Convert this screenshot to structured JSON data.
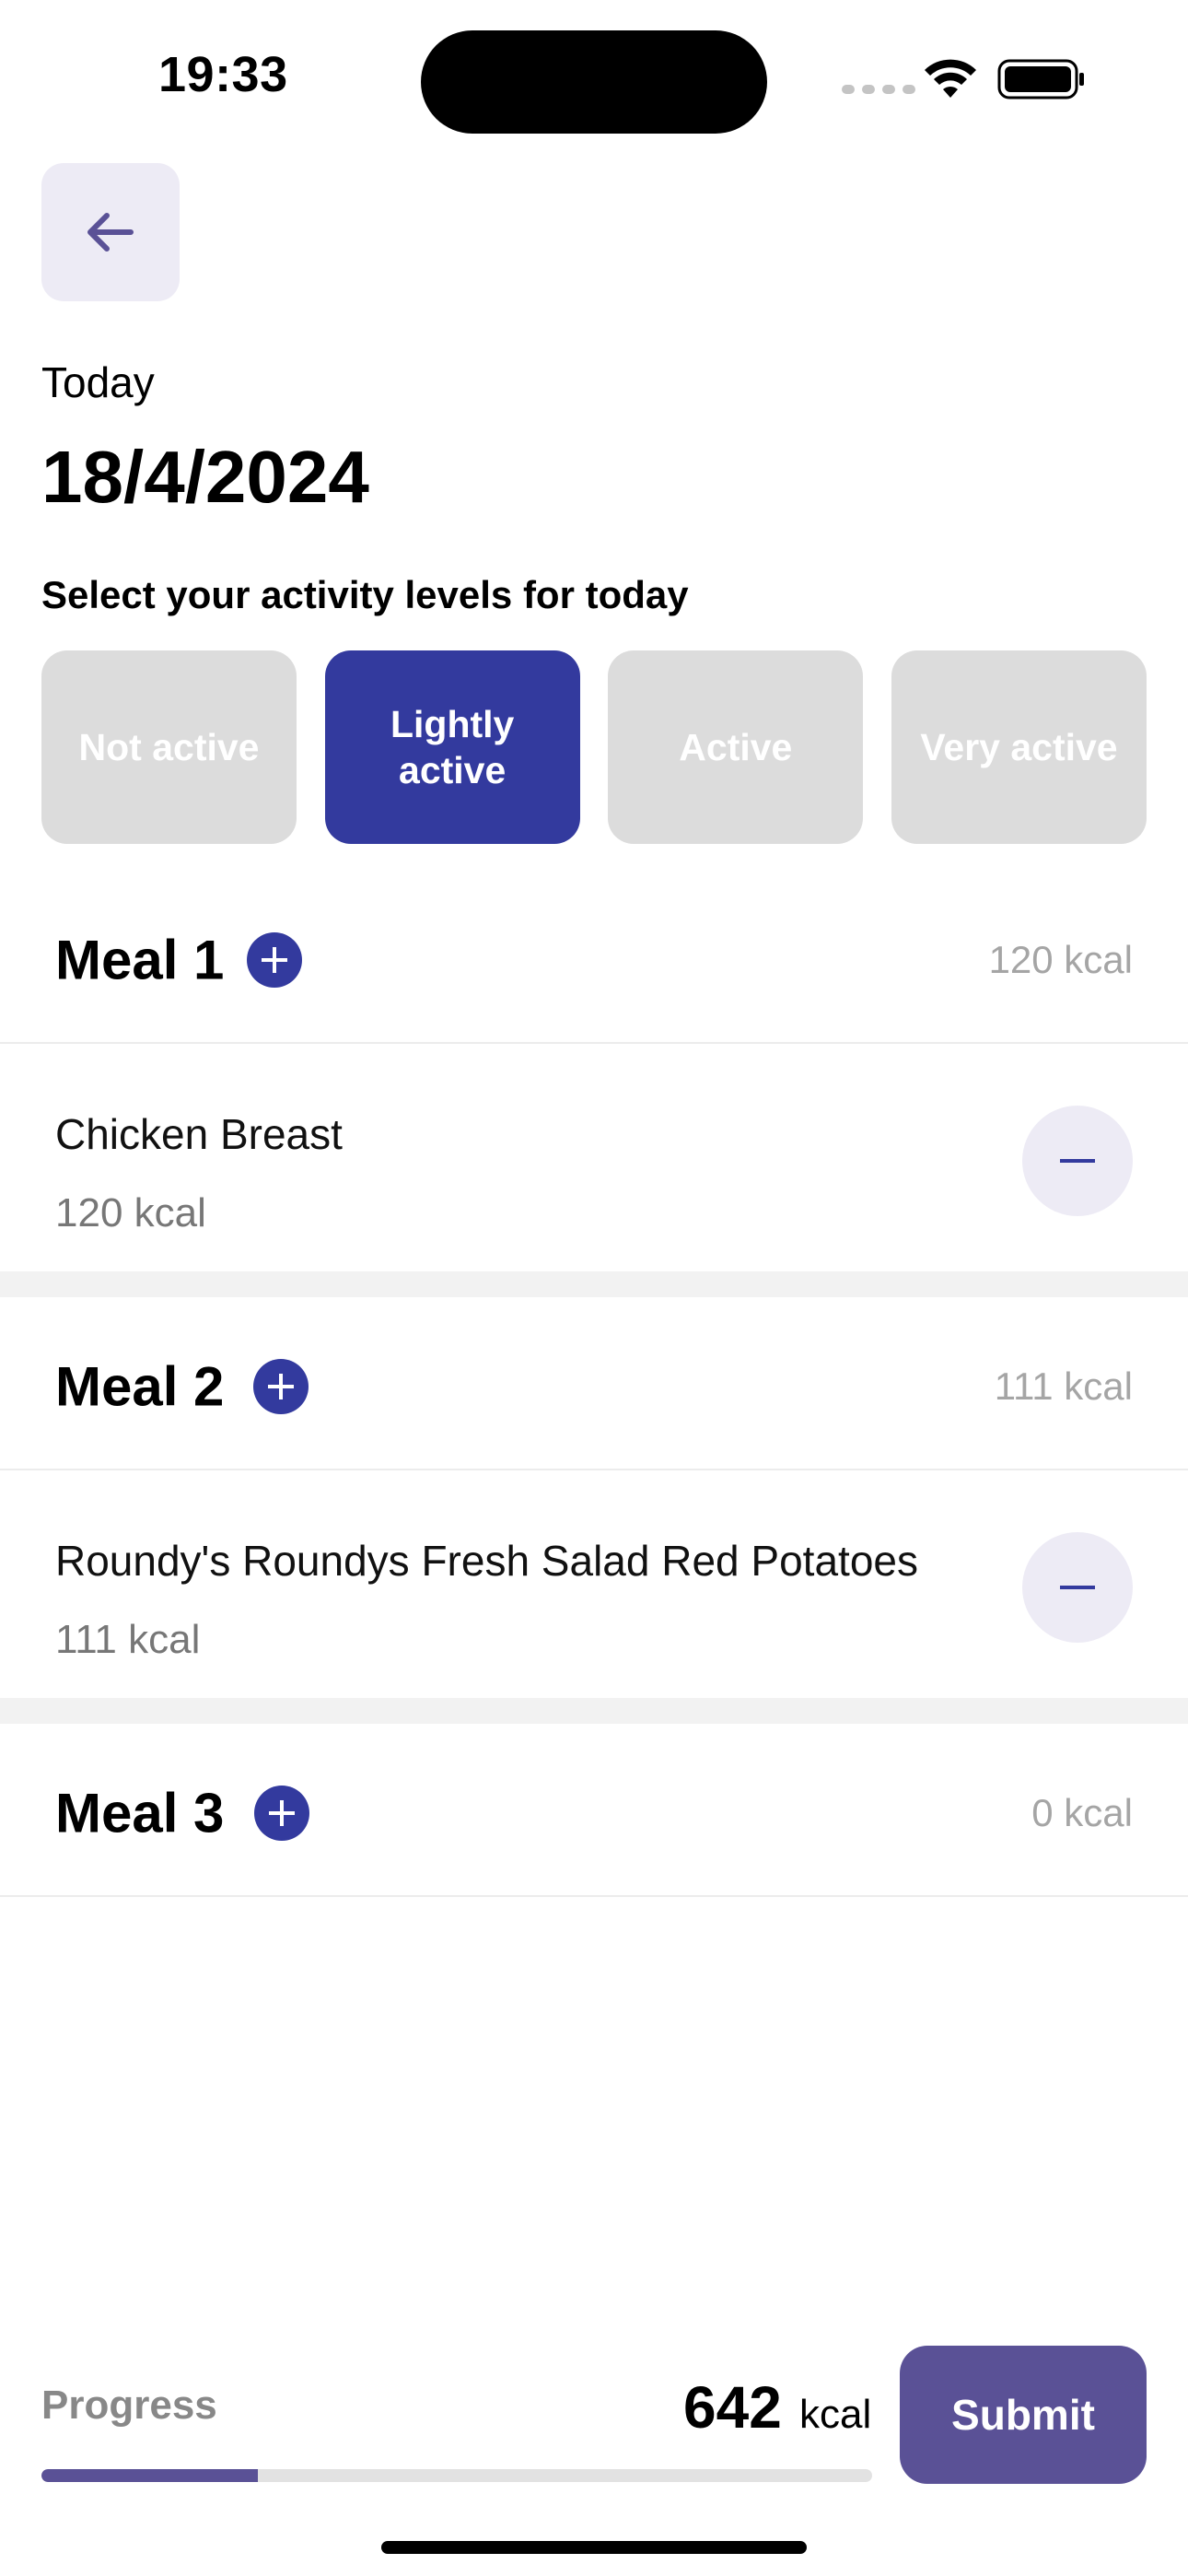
{
  "status_bar": {
    "time": "19:33",
    "icons": [
      "cellular-signal-icon",
      "wifi-icon",
      "battery-icon"
    ]
  },
  "header": {
    "back_icon": "arrow-left-icon",
    "date_label": "Today",
    "date_value": "18/4/2024"
  },
  "activity": {
    "prompt": "Select your activity levels for today",
    "options": [
      "Not active",
      "Lightly active",
      "Active",
      "Very active"
    ],
    "selected": "Lightly active"
  },
  "meals": [
    {
      "title": "Meal 1",
      "total": "120 kcal",
      "items": [
        {
          "name": "Chicken Breast",
          "kcal": "120 kcal"
        }
      ]
    },
    {
      "title": "Meal 2",
      "total": "111 kcal",
      "items": [
        {
          "name": "Roundy's Roundys Fresh Salad Red Potatoes",
          "kcal": "111 kcal"
        }
      ]
    },
    {
      "title": "Meal 3",
      "total": "0 kcal",
      "items": []
    }
  ],
  "footer": {
    "progress_label": "Progress",
    "progress_value": "642",
    "progress_unit": "kcal",
    "progress_fraction": 0.26,
    "submit_label": "Submit"
  },
  "colors": {
    "primary": "#333a9e",
    "submit": "#5a5196",
    "inactive_chip": "#dcdcdc",
    "soft_bg": "#edebf5"
  }
}
